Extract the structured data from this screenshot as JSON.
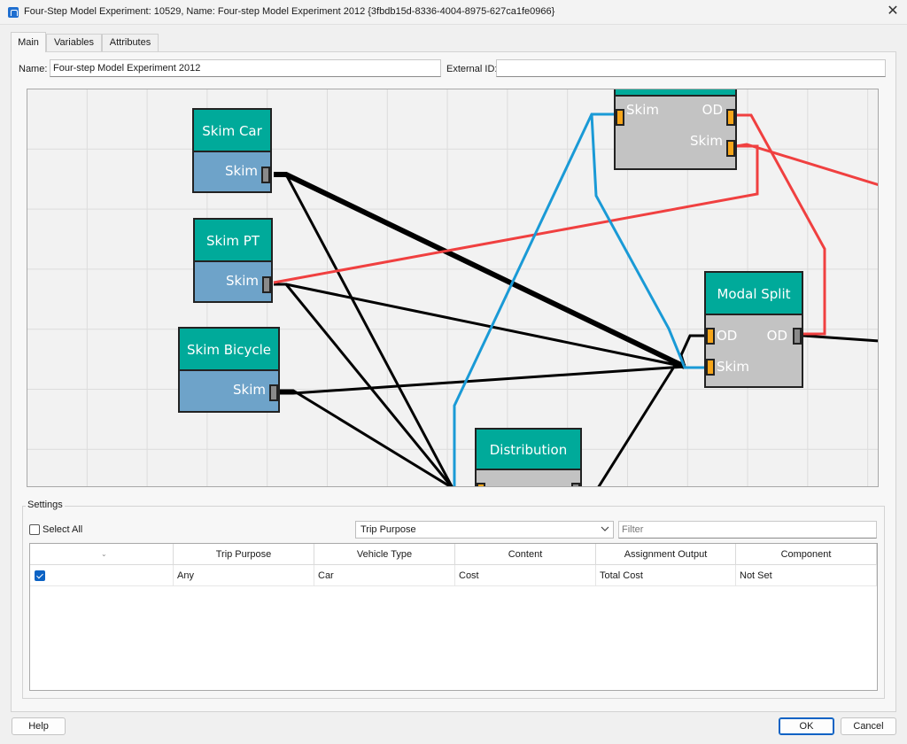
{
  "window": {
    "title": "Four-Step Model Experiment: 10529, Name: Four-step Model Experiment 2012  {3fbdb15d-8336-4004-8975-627ca1fe0966}",
    "icon": "app-icon"
  },
  "tabs": [
    {
      "label": "Main",
      "active": true
    },
    {
      "label": "Variables",
      "active": false
    },
    {
      "label": "Attributes",
      "active": false
    }
  ],
  "form": {
    "name_label": "Name:",
    "name_value": "Four-step Model Experiment 2012",
    "external_id_label": "External ID:",
    "external_id_value": ""
  },
  "diagram": {
    "nodes": {
      "skim_car": {
        "title": "Skim Car",
        "port": "Skim"
      },
      "skim_pt": {
        "title": "Skim PT",
        "port": "Skim"
      },
      "skim_bicycle": {
        "title": "Skim Bicycle",
        "port": "Skim"
      },
      "top_node": {
        "in_port": "Skim",
        "out_port_1": "OD",
        "out_port_2": "Skim"
      },
      "modal_split": {
        "title": "Modal Split",
        "in_port_1": "OD",
        "in_port_2": "Skim",
        "out_port": "OD"
      },
      "distribution": {
        "title": "Distribution"
      }
    },
    "colors": {
      "node_header": "#00aa9a",
      "skim_body": "#6ea3c9",
      "process_body": "#c3c3c3",
      "port_input": "#f5a51a",
      "wire_black": "#000000",
      "wire_red": "#f04040",
      "wire_blue": "#1a9ad6"
    }
  },
  "settings": {
    "legend": "Settings",
    "select_all_label": "Select All",
    "select_all_checked": false,
    "group_by_value": "Trip Purpose",
    "filter_placeholder": "Filter",
    "columns": [
      "Trip Purpose",
      "Vehicle Type",
      "Content",
      "Assignment Output",
      "Component"
    ],
    "rows": [
      {
        "checked": true,
        "cells": [
          "Any",
          "Car",
          "Cost",
          "Total Cost",
          "Not Set"
        ]
      }
    ]
  },
  "buttons": {
    "help": "Help",
    "ok": "OK",
    "cancel": "Cancel"
  }
}
